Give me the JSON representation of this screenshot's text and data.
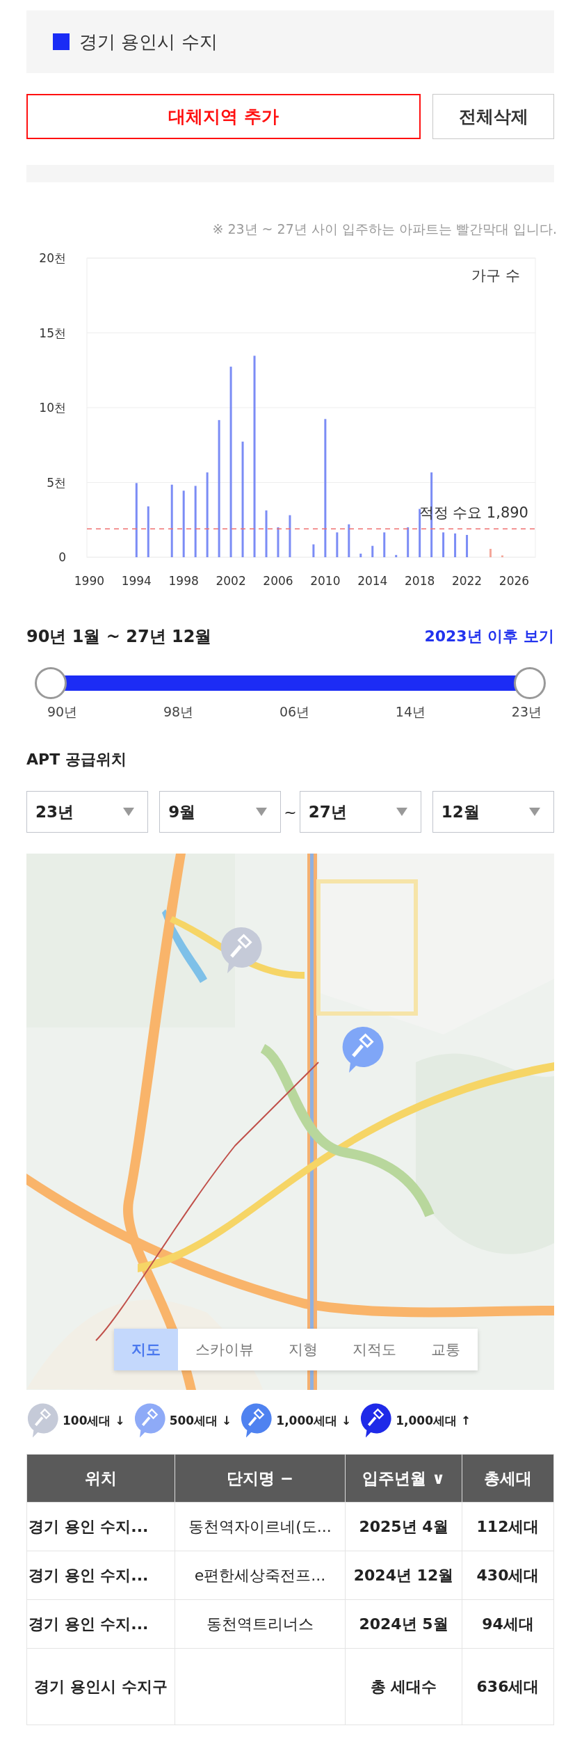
{
  "region_chip": {
    "label": "경기 용인시 수지",
    "color": "#1a2cf5"
  },
  "buttons": [
    {
      "label": "대체지역 추가",
      "kind": "primary"
    },
    {
      "label": "전체삭제",
      "kind": "plain"
    }
  ],
  "chart_note": "※ 23년 ~ 27년 사이 입주하는 아파트는 빨간막대 입니다.",
  "chart_data": {
    "type": "bar",
    "ylabel": "가구 수",
    "x": [
      1994,
      1995,
      1997,
      1998,
      1999,
      2000,
      2001,
      2002,
      2003,
      2004,
      2005,
      2006,
      2007,
      2009,
      2010,
      2011,
      2012,
      2013,
      2014,
      2015,
      2016,
      2017,
      2018,
      2019,
      2020,
      2021,
      2022,
      2024,
      2025
    ],
    "series": [
      {
        "color": "#7b8cf5",
        "values": [
          4.96,
          3.4,
          4.85,
          4.45,
          4.77,
          5.67,
          9.17,
          12.74,
          7.73,
          13.47,
          3.13,
          2.0,
          2.81,
          0.86,
          9.24,
          1.66,
          2.2,
          0.24,
          0.76,
          1.66,
          0.15,
          2.0,
          3.23,
          5.67,
          1.66,
          1.59,
          1.49,
          null,
          null
        ]
      },
      {
        "color": "#f4a79a",
        "values": [
          null,
          null,
          null,
          null,
          null,
          null,
          null,
          null,
          null,
          null,
          null,
          null,
          null,
          null,
          null,
          null,
          null,
          null,
          null,
          null,
          null,
          null,
          null,
          null,
          null,
          null,
          null,
          0.56,
          0.12
        ]
      }
    ],
    "xlim": [
      1989.8,
      2027.8
    ],
    "ylim": [
      0,
      20
    ],
    "yticks": [
      {
        "value": 0,
        "label": "0"
      },
      {
        "value": 5,
        "label": "5천"
      },
      {
        "value": 10,
        "label": "10천"
      },
      {
        "value": 15,
        "label": "15천"
      },
      {
        "value": 20,
        "label": "20천"
      }
    ],
    "xticks": [
      1990,
      1994,
      1998,
      2002,
      2006,
      2010,
      2014,
      2018,
      2022,
      2026
    ],
    "grid": true,
    "ref_lines": [
      {
        "axis": "y",
        "value": 1.89,
        "label": "적정 수요 1,890",
        "color": "#f07070"
      }
    ]
  },
  "range": {
    "label": "90년 1월 ~ 27년 12월",
    "link": "2023년 이후 보기",
    "thumbs": [
      {
        "level": 0
      },
      {
        "level": 1
      }
    ],
    "ticks": [
      "90년",
      "98년",
      "06년",
      "14년",
      "23년"
    ]
  },
  "supply": {
    "title": "APT 공급위치",
    "selects": [
      {
        "value": "23년"
      },
      {
        "value": "9월"
      },
      {
        "value": "27년"
      },
      {
        "value": "12월"
      }
    ],
    "separator": "~"
  },
  "map": {
    "markers": [
      {
        "color": "#c5cad8"
      },
      {
        "color": "#7fa6f7"
      }
    ],
    "map_types": [
      {
        "label": "지도",
        "selected": true
      },
      {
        "label": "스카이뷰",
        "selected": false
      },
      {
        "label": "지형",
        "selected": false
      },
      {
        "label": "지적도",
        "selected": false
      },
      {
        "label": "교통",
        "selected": false
      }
    ]
  },
  "legend": [
    {
      "label": "100세대 ↓",
      "color": "#c5cad8"
    },
    {
      "label": "500세대 ↓",
      "color": "#8eaaf7"
    },
    {
      "label": "1,000세대 ↓",
      "color": "#4f82f0"
    },
    {
      "label": "1,000세대 ↑",
      "color": "#1f2ae8"
    }
  ],
  "table": {
    "columns": [
      "위치",
      "단지명 −",
      "입주년월 ∨",
      "총세대"
    ],
    "rows": [
      [
        "경기 용인 수지...",
        "동천역자이르네(도...",
        "2025년 4월",
        "112세대"
      ],
      [
        "경기 용인 수지...",
        "e편한세상죽전프...",
        "2024년 12월",
        "430세대"
      ],
      [
        "경기 용인 수지...",
        "동천역트리너스",
        "2024년 5월",
        "94세대"
      ]
    ],
    "total": {
      "location": "경기 용인시 수지구",
      "label": "총 세대수",
      "count": "636세대"
    }
  }
}
